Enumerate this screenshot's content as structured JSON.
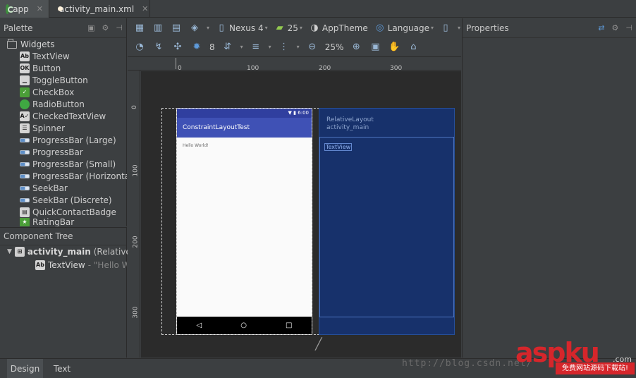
{
  "tabs": [
    {
      "label": "app",
      "icon": "android-app-icon"
    },
    {
      "label": "activity_main.xml",
      "icon": "xml-file-icon"
    }
  ],
  "palette": {
    "title": "Palette",
    "group": "Widgets",
    "items": [
      {
        "label": "TextView",
        "icon": "text-view-icon"
      },
      {
        "label": "Button",
        "icon": "button-icon"
      },
      {
        "label": "ToggleButton",
        "icon": "toggle-button-icon"
      },
      {
        "label": "CheckBox",
        "icon": "checkbox-icon"
      },
      {
        "label": "RadioButton",
        "icon": "radio-button-icon"
      },
      {
        "label": "CheckedTextView",
        "icon": "checked-text-view-icon"
      },
      {
        "label": "Spinner",
        "icon": "spinner-icon"
      },
      {
        "label": "ProgressBar (Large)",
        "icon": "progress-bar-icon"
      },
      {
        "label": "ProgressBar",
        "icon": "progress-bar-icon"
      },
      {
        "label": "ProgressBar (Small)",
        "icon": "progress-bar-icon"
      },
      {
        "label": "ProgressBar (Horizontal)",
        "icon": "progress-bar-icon"
      },
      {
        "label": "SeekBar",
        "icon": "seekbar-icon"
      },
      {
        "label": "SeekBar (Discrete)",
        "icon": "seekbar-icon"
      },
      {
        "label": "QuickContactBadge",
        "icon": "quick-contact-badge-icon"
      },
      {
        "label": "RatingBar",
        "icon": "rating-bar-icon"
      }
    ]
  },
  "component_tree": {
    "title": "Component Tree",
    "root_label": "activity_main",
    "root_type": "(RelativeLayout)",
    "child_label": "TextView",
    "child_value": "- \"Hello World!\""
  },
  "toolbar": {
    "device": "Nexus 4",
    "api": "25",
    "theme": "AppTheme",
    "language": "Language",
    "margin": "8",
    "zoom": "25%"
  },
  "rulers": {
    "x_labels": [
      "0",
      "100",
      "200",
      "300"
    ],
    "y_labels": [
      "0",
      "100",
      "200",
      "300"
    ]
  },
  "preview": {
    "status_time": "6:00",
    "app_title": "ConstraintLayoutTest",
    "hello_text": "Hello World!"
  },
  "blueprint": {
    "layout_type": "RelativeLayout",
    "layout_id": "activity_main",
    "text_view_label": "TextView"
  },
  "properties": {
    "title": "Properties"
  },
  "bottom_tabs": [
    {
      "label": "Design",
      "active": true
    },
    {
      "label": "Text",
      "active": false
    }
  ],
  "watermark": {
    "url": "http://blog.csdn.net/",
    "brand": "aspku",
    "domain": ".com",
    "subtitle": "免费网站源码下载站!"
  }
}
